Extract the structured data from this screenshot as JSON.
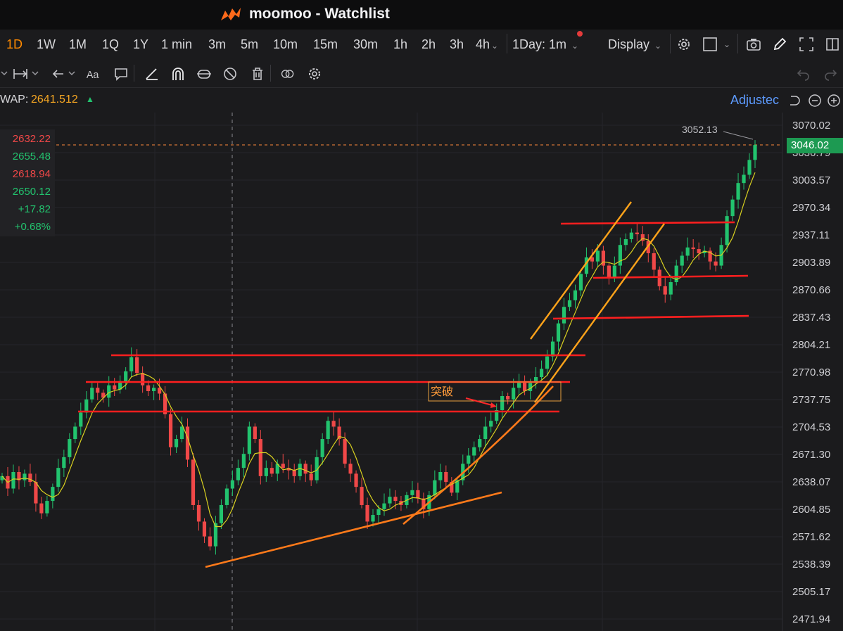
{
  "app": {
    "title": "moomoo - Watchlist"
  },
  "timeframes": {
    "items": [
      "1D",
      "1W",
      "1M",
      "1Q",
      "1Y",
      "1 min",
      "3m",
      "5m",
      "10m",
      "15m",
      "30m",
      "1h",
      "2h",
      "3h",
      "4h"
    ],
    "active": "1D",
    "interval_select": "1Day: 1m",
    "display_label": "Display"
  },
  "vwap": {
    "label": "WAP:",
    "value": "2641.512"
  },
  "adjusted_label": "Adjustec",
  "ohlc": {
    "open": "2632.22",
    "high": "2655.48",
    "low": "2618.94",
    "close": "2650.12",
    "change": "+17.82",
    "change_pct": "+0.68%"
  },
  "price_axis": [
    "3070.02",
    "3036.79",
    "3003.57",
    "2970.34",
    "2937.11",
    "2903.89",
    "2870.66",
    "2837.43",
    "2804.21",
    "2770.98",
    "2737.75",
    "2704.53",
    "2671.30",
    "2638.07",
    "2604.85",
    "2571.62",
    "2538.39",
    "2505.17",
    "2471.94"
  ],
  "current_price": "3046.02",
  "high_marker": "3052.13",
  "annotation": "突破",
  "colors": {
    "up": "#22c36e",
    "down": "#f04848",
    "accent": "#ff8a00",
    "hline": "#ff1f1f",
    "trendline": "#ff7a1a",
    "channel": "#ffa31a",
    "ma": "#d8d020"
  },
  "chart_data": {
    "type": "candlestick",
    "ylim": [
      2471.94,
      3070.02
    ],
    "closes": [
      2645,
      2630,
      2650,
      2640,
      2648,
      2638,
      2612,
      2600,
      2615,
      2632,
      2655,
      2668,
      2690,
      2705,
      2722,
      2738,
      2752,
      2746,
      2740,
      2755,
      2750,
      2760,
      2772,
      2789,
      2770,
      2755,
      2748,
      2752,
      2745,
      2720,
      2680,
      2690,
      2705,
      2665,
      2610,
      2590,
      2572,
      2560,
      2588,
      2610,
      2630,
      2640,
      2655,
      2672,
      2705,
      2690,
      2645,
      2655,
      2648,
      2660,
      2655,
      2652,
      2645,
      2660,
      2648,
      2640,
      2668,
      2690,
      2712,
      2705,
      2690,
      2660,
      2648,
      2632,
      2610,
      2590,
      2598,
      2605,
      2612,
      2620,
      2615,
      2610,
      2622,
      2628,
      2618,
      2605,
      2622,
      2640,
      2650,
      2638,
      2625,
      2640,
      2660,
      2670,
      2680,
      2690,
      2705,
      2712,
      2725,
      2742,
      2738,
      2752,
      2760,
      2748,
      2758,
      2765,
      2775,
      2790,
      2808,
      2830,
      2850,
      2858,
      2870,
      2890,
      2910,
      2905,
      2918,
      2900,
      2885,
      2900,
      2925,
      2932,
      2940,
      2938,
      2930,
      2915,
      2895,
      2875,
      2865,
      2880,
      2900,
      2912,
      2922,
      2920,
      2915,
      2918,
      2905,
      2900,
      2925,
      2960,
      2980,
      3000,
      3010,
      3028,
      3046
    ]
  }
}
